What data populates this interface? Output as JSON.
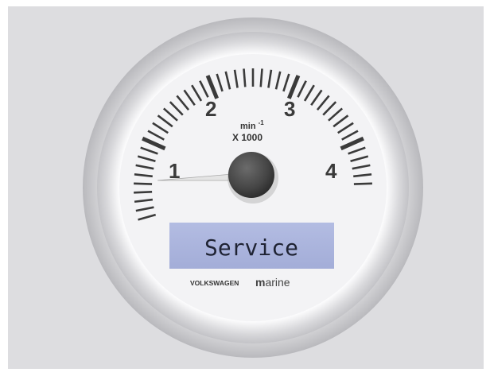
{
  "gauge": {
    "scale_labels": [
      "1",
      "2",
      "3",
      "4"
    ],
    "unit_base": "min",
    "unit_exponent": "-1",
    "multiplier": "X 1000",
    "display_text": "Service",
    "brand_left": "VOLKSWAGEN",
    "brand_marine_m": "m",
    "brand_marine_rest": "arine",
    "needle_value": 0.4,
    "colors": {
      "background": "#dddde0",
      "face": "#f4f4f6",
      "bezel": "#d6d6d9",
      "ticks": "#3a3a3a",
      "lcd": "#a9b3dc",
      "lcd_text": "#1f2333",
      "hub": "#474747",
      "needle": "#e6e6e6"
    }
  }
}
